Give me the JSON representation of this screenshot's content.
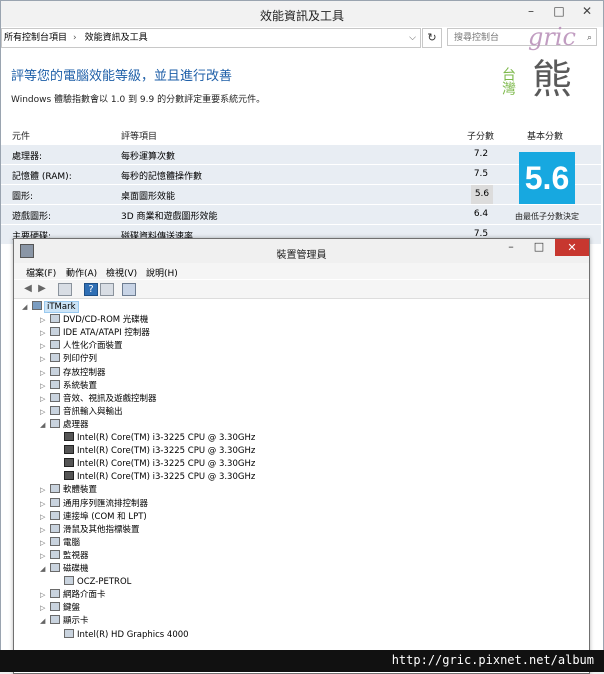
{
  "window": {
    "title": "效能資訊及工具"
  },
  "addressbar": {
    "segments": [
      "所有控制台項目",
      "效能資訊及工具"
    ]
  },
  "search": {
    "placeholder": "搜尋控制台"
  },
  "watermark": {
    "script_text": "gric",
    "taiwan_text": "台灣",
    "bear_text": "熊",
    "url": "http://gric.pixnet.net/album"
  },
  "perf": {
    "heading": "評等您的電腦效能等級，並且進行改善",
    "subtext": "Windows 體驗指數會以 1.0 到 9.9 的分數評定重要系統元件。",
    "columns": [
      "元件",
      "評等項目",
      "子分數",
      "基本分數"
    ],
    "rows": [
      {
        "component": "處理器:",
        "item": "每秒運算次數",
        "score": "7.2"
      },
      {
        "component": "記憶體 (RAM):",
        "item": "每秒的記憶體操作數",
        "score": "7.5"
      },
      {
        "component": "圖形:",
        "item": "桌面圖形效能",
        "score": "5.6"
      },
      {
        "component": "遊戲圖形:",
        "item": "3D 商業和遊戲圖形效能",
        "score": "6.4"
      },
      {
        "component": "主要硬碟:",
        "item": "磁碟資料傳送速率",
        "score": "7.5"
      }
    ],
    "base_score": "5.6",
    "base_score_desc": "由最低子分數決定",
    "base_score_color": "#17a8e0"
  },
  "devmgr": {
    "title": "裝置管理員",
    "menu": [
      "檔案(F)",
      "動作(A)",
      "檢視(V)",
      "說明(H)"
    ],
    "root": "iTMark",
    "nodes": [
      {
        "label": "DVD/CD-ROM 光碟機",
        "level": 1,
        "expander": "▷"
      },
      {
        "label": "IDE ATA/ATAPI 控制器",
        "level": 1,
        "expander": "▷"
      },
      {
        "label": "人性化介面裝置",
        "level": 1,
        "expander": "▷"
      },
      {
        "label": "列印佇列",
        "level": 1,
        "expander": "▷"
      },
      {
        "label": "存放控制器",
        "level": 1,
        "expander": "▷"
      },
      {
        "label": "系統裝置",
        "level": 1,
        "expander": "▷"
      },
      {
        "label": "音效、視訊及遊戲控制器",
        "level": 1,
        "expander": "▷"
      },
      {
        "label": "音訊輸入與輸出",
        "level": 1,
        "expander": "▷"
      },
      {
        "label": "處理器",
        "level": 1,
        "expander": "◢"
      },
      {
        "label": "Intel(R) Core(TM) i3-3225 CPU @ 3.30GHz",
        "level": 2,
        "expander": ""
      },
      {
        "label": "Intel(R) Core(TM) i3-3225 CPU @ 3.30GHz",
        "level": 2,
        "expander": ""
      },
      {
        "label": "Intel(R) Core(TM) i3-3225 CPU @ 3.30GHz",
        "level": 2,
        "expander": ""
      },
      {
        "label": "Intel(R) Core(TM) i3-3225 CPU @ 3.30GHz",
        "level": 2,
        "expander": ""
      },
      {
        "label": "軟體裝置",
        "level": 1,
        "expander": "▷"
      },
      {
        "label": "通用序列匯流排控制器",
        "level": 1,
        "expander": "▷"
      },
      {
        "label": "連接埠 (COM 和 LPT)",
        "level": 1,
        "expander": "▷"
      },
      {
        "label": "滑鼠及其他指標裝置",
        "level": 1,
        "expander": "▷"
      },
      {
        "label": "電腦",
        "level": 1,
        "expander": "▷"
      },
      {
        "label": "監視器",
        "level": 1,
        "expander": "▷"
      },
      {
        "label": "磁碟機",
        "level": 1,
        "expander": "◢"
      },
      {
        "label": "OCZ-PETROL",
        "level": 2,
        "expander": ""
      },
      {
        "label": "網路介面卡",
        "level": 1,
        "expander": "▷"
      },
      {
        "label": "鍵盤",
        "level": 1,
        "expander": "▷"
      },
      {
        "label": "顯示卡",
        "level": 1,
        "expander": "◢"
      },
      {
        "label": "Intel(R) HD Graphics 4000",
        "level": 2,
        "expander": ""
      }
    ]
  }
}
